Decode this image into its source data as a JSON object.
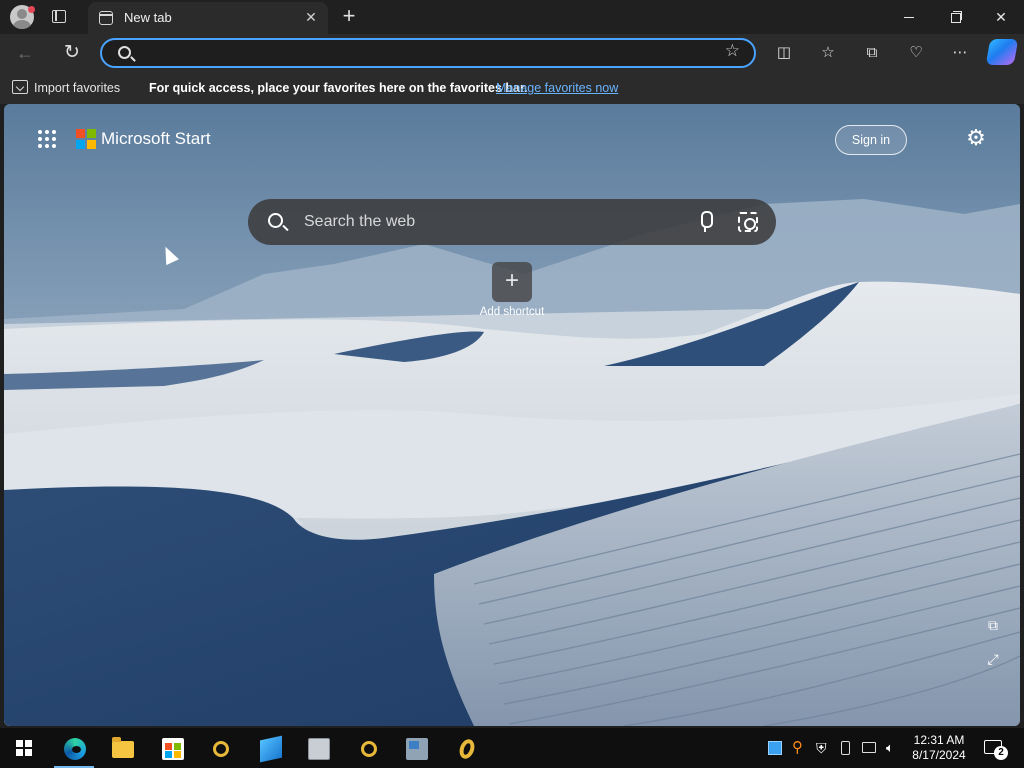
{
  "browser": {
    "tab": {
      "title": "New tab"
    },
    "address_bar": {
      "value": "",
      "placeholder": ""
    },
    "favorites_bar": {
      "import_label": "Import favorites",
      "message": "For quick access, place your favorites here on the favorites bar.",
      "manage_link": "Manage favorites now"
    }
  },
  "start_page": {
    "brand": "Microsoft Start",
    "sign_in_label": "Sign in",
    "search": {
      "placeholder": "Search the web"
    },
    "add_shortcut_label": "Add shortcut"
  },
  "taskbar": {
    "time": "12:31 AM",
    "date": "8/17/2024",
    "notification_count": "2",
    "apps": [
      "edge-icon",
      "file-explorer-icon",
      "store-icon",
      "ring-app-icon",
      "blue-app-icon",
      "window-app-icon",
      "ring-app-icon",
      "computer-app-icon",
      "gold-ring-app-icon"
    ]
  },
  "colors": {
    "accent": "#4aa3ff",
    "link": "#6ab4ff",
    "titlebar": "#202020",
    "toolbar": "#2b2b2b",
    "taskbar": "#0f0f0f"
  }
}
